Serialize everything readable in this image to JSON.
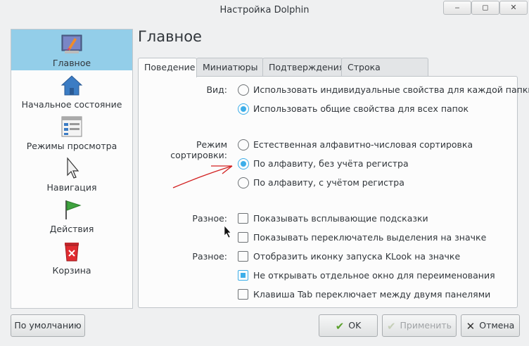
{
  "window": {
    "title": "Настройка Dolphin",
    "min_label": "‒",
    "max_label": "◻",
    "close_label": "✕"
  },
  "sidebar": {
    "items": [
      {
        "label": "Главное",
        "icon": "brush-icon"
      },
      {
        "label": "Начальное состояние",
        "icon": "home-icon"
      },
      {
        "label": "Режимы просмотра",
        "icon": "view-modes-icon"
      },
      {
        "label": "Навигация",
        "icon": "pointer-icon"
      },
      {
        "label": "Действия",
        "icon": "flag-icon"
      },
      {
        "label": "Корзина",
        "icon": "trash-icon"
      }
    ]
  },
  "page": {
    "title": "Главное"
  },
  "tabs": [
    "Поведение",
    "Миниатюры",
    "Подтверждения",
    "Строка состояния"
  ],
  "behavior": {
    "view_label": "Вид:",
    "view_options": [
      {
        "label": "Использовать индивидуальные свойства для каждой папки",
        "selected": false
      },
      {
        "label": "Использовать общие свойства для всех папок",
        "selected": true
      }
    ],
    "sort_label": "Режим сортировки:",
    "sort_options": [
      {
        "label": "Естественная алфавитно-числовая сортировка",
        "selected": false
      },
      {
        "label": "По алфавиту, без учёта регистра",
        "selected": true
      },
      {
        "label": "По алфавиту, с учётом регистра",
        "selected": false
      }
    ],
    "misc_label_1": "Разное:",
    "misc_label_2": "Разное:",
    "misc_options": [
      {
        "label": "Показывать всплывающие подсказки",
        "checked": false
      },
      {
        "label": "Показывать переключатель выделения на значке",
        "checked": false
      },
      {
        "label": "Отобразить иконку запуска KLook на значке",
        "checked": false
      },
      {
        "label": "Не открывать отдельное окно для переименования",
        "checked": true
      },
      {
        "label": "Клавиша Tab переключает между двумя панелями",
        "checked": false
      }
    ]
  },
  "footer": {
    "defaults_label": "По умолчанию",
    "ok_label": "OK",
    "apply_label": "Применить",
    "cancel_label": "Отмена"
  },
  "colors": {
    "accent": "#3daee9",
    "selection": "#93cee9",
    "annotation_arrow": "#d22020"
  }
}
